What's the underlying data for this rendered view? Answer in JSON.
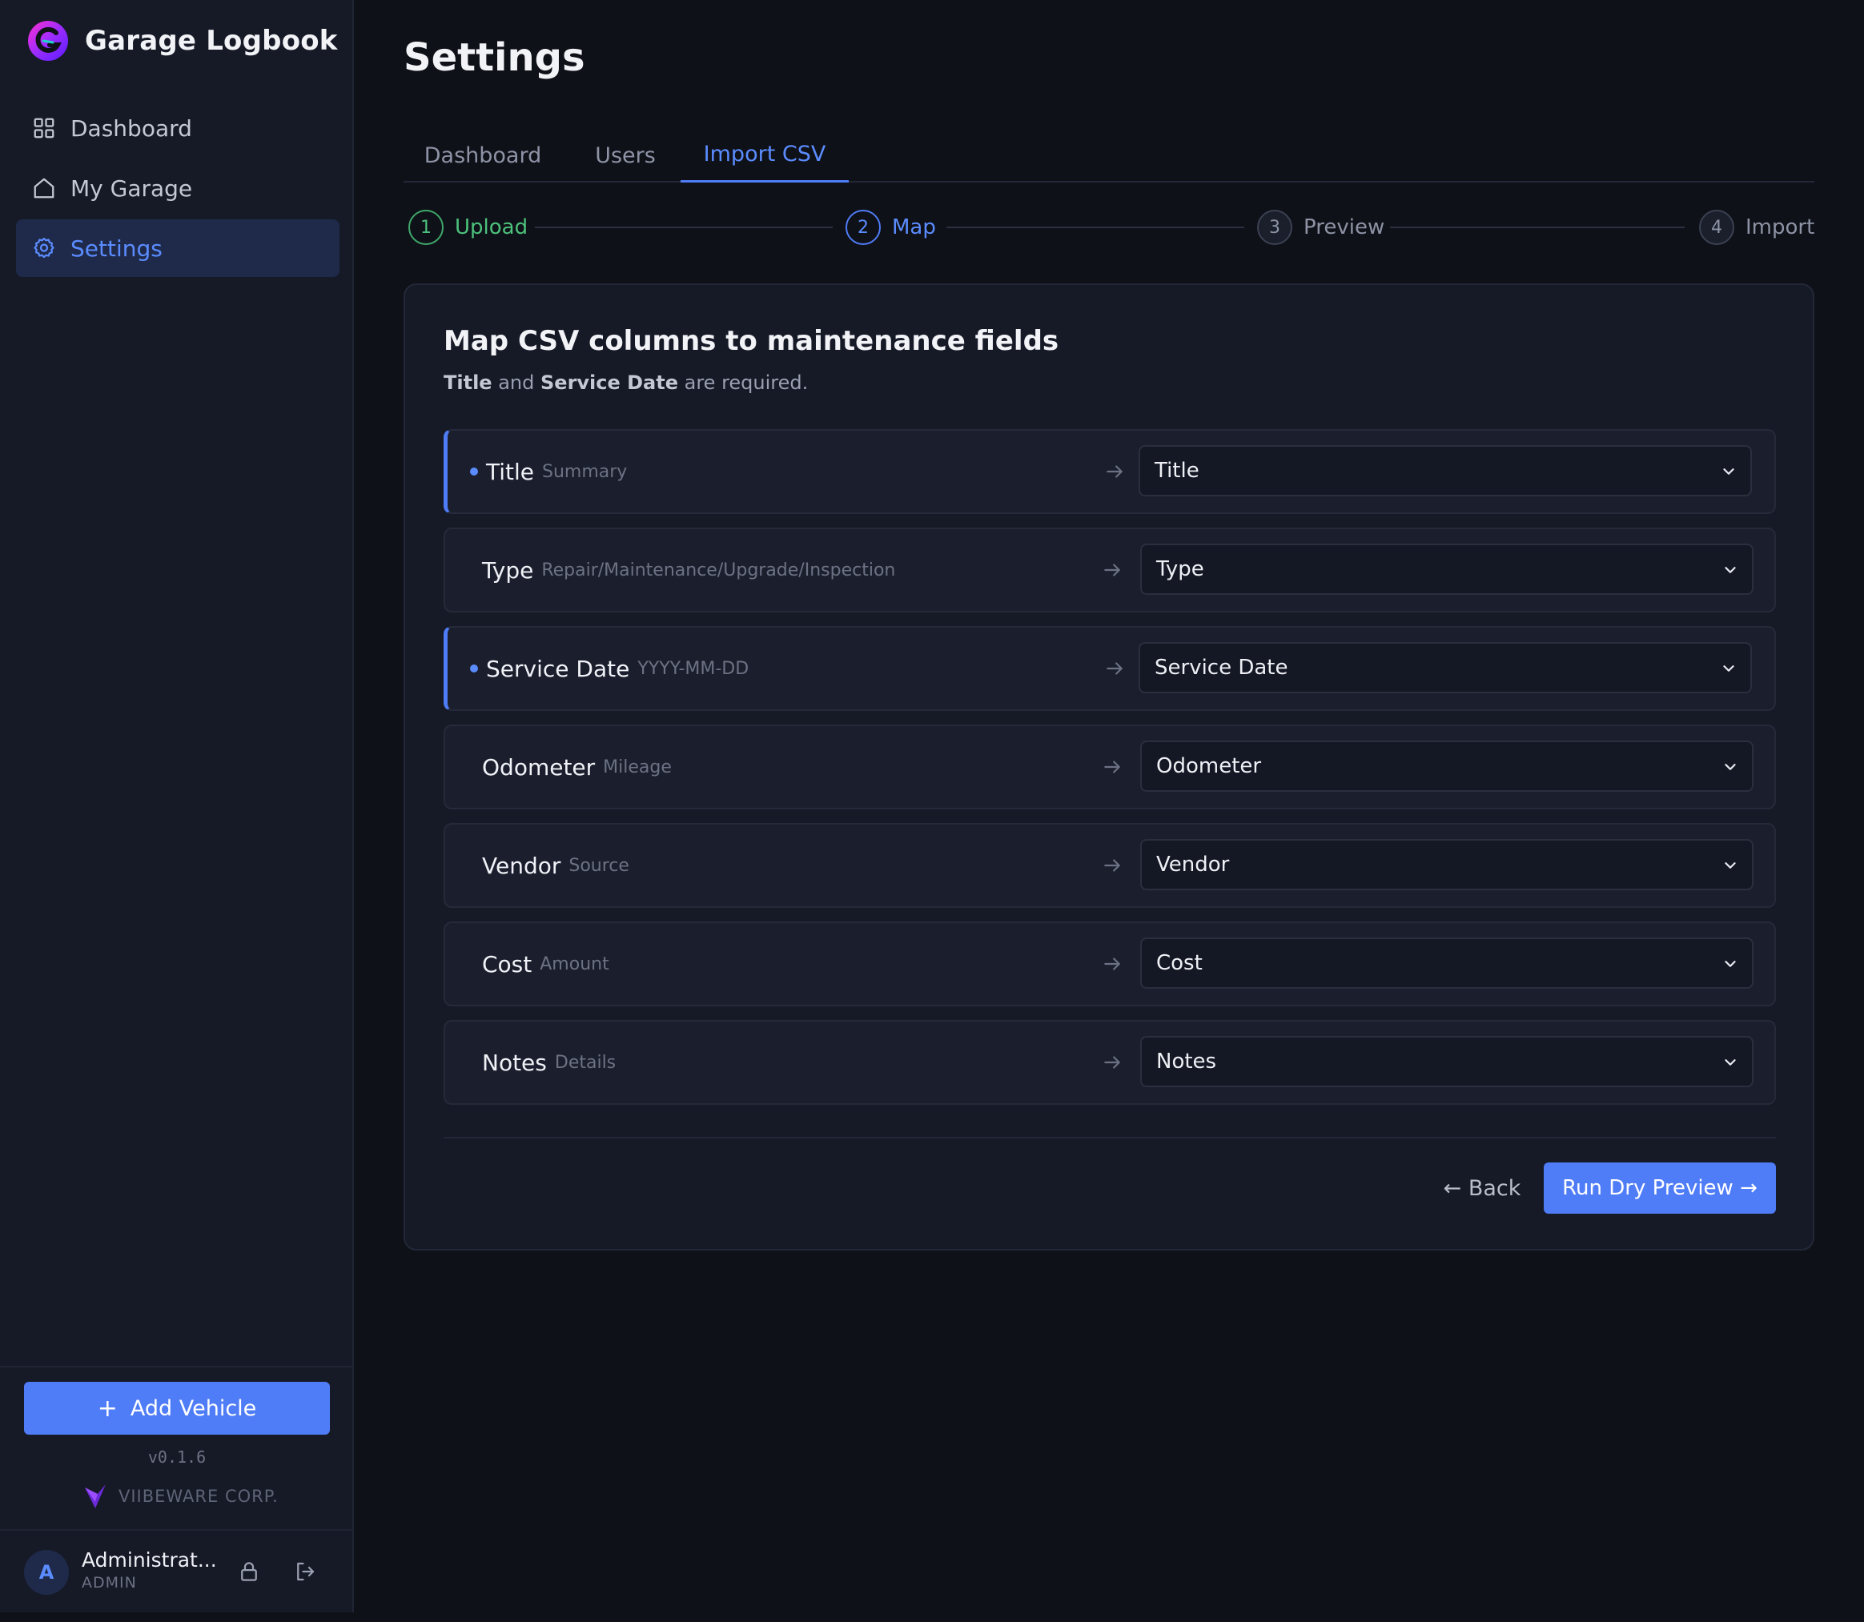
{
  "app": {
    "name": "Garage Logbook"
  },
  "sidebar": {
    "items": [
      {
        "label": "Dashboard",
        "icon": "grid-icon"
      },
      {
        "label": "My Garage",
        "icon": "home-icon"
      },
      {
        "label": "Settings",
        "icon": "gear-icon",
        "active": true
      }
    ],
    "add_vehicle_label": "Add Vehicle",
    "version": "v0.1.6",
    "corp": "VIIBEWARE CORP."
  },
  "user": {
    "avatar_initial": "A",
    "name": "Administrat...",
    "role": "ADMIN"
  },
  "page": {
    "title": "Settings"
  },
  "tabs": [
    {
      "label": "Dashboard"
    },
    {
      "label": "Users"
    },
    {
      "label": "Import CSV",
      "active": true
    }
  ],
  "steps": [
    {
      "number": "1",
      "label": "Upload",
      "state": "done"
    },
    {
      "number": "2",
      "label": "Map",
      "state": "current"
    },
    {
      "number": "3",
      "label": "Preview",
      "state": "todo"
    },
    {
      "number": "4",
      "label": "Import",
      "state": "todo"
    }
  ],
  "card": {
    "title": "Map CSV columns to maintenance fields",
    "sub_b1": "Title",
    "sub_t1": " and ",
    "sub_b2": "Service Date",
    "sub_t2": " are required."
  },
  "mappings": [
    {
      "field": "Title",
      "hint": "Summary",
      "value": "Title",
      "required": true
    },
    {
      "field": "Type",
      "hint": "Repair/Maintenance/Upgrade/Inspection",
      "value": "Type",
      "required": false
    },
    {
      "field": "Service Date",
      "hint": "YYYY-MM-DD",
      "value": "Service Date",
      "required": true
    },
    {
      "field": "Odometer",
      "hint": "Mileage",
      "value": "Odometer",
      "required": false
    },
    {
      "field": "Vendor",
      "hint": "Source",
      "value": "Vendor",
      "required": false
    },
    {
      "field": "Cost",
      "hint": "Amount",
      "value": "Cost",
      "required": false
    },
    {
      "field": "Notes",
      "hint": "Details",
      "value": "Notes",
      "required": false
    }
  ],
  "actions": {
    "back_label": "← Back",
    "run_label": "Run Dry Preview →"
  },
  "colors": {
    "accent": "#4f7cf7",
    "success": "#4cc27c",
    "background": "#0f1118",
    "surface": "#161a27"
  }
}
